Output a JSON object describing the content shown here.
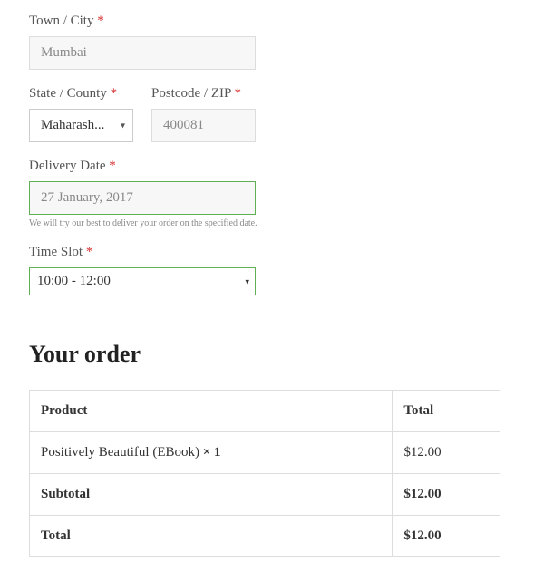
{
  "town": {
    "label": "Town / City",
    "value": "Mumbai"
  },
  "state": {
    "label": "State / County",
    "value": "Maharash..."
  },
  "postcode": {
    "label": "Postcode / ZIP",
    "value": "400081"
  },
  "delivery_date": {
    "label": "Delivery Date",
    "value": "27 January, 2017",
    "help": "We will try our best to deliver your order on the specified date."
  },
  "time_slot": {
    "label": "Time Slot",
    "value": "10:00 - 12:00"
  },
  "order": {
    "heading": "Your order",
    "headers": {
      "product": "Product",
      "total": "Total"
    },
    "items": [
      {
        "name": "Positively Beautiful (EBook) ",
        "qty": " × 1",
        "total": "$12.00"
      }
    ],
    "subtotal": {
      "label": "Subtotal",
      "value": "$12.00"
    },
    "total": {
      "label": "Total",
      "value": "$12.00"
    }
  }
}
